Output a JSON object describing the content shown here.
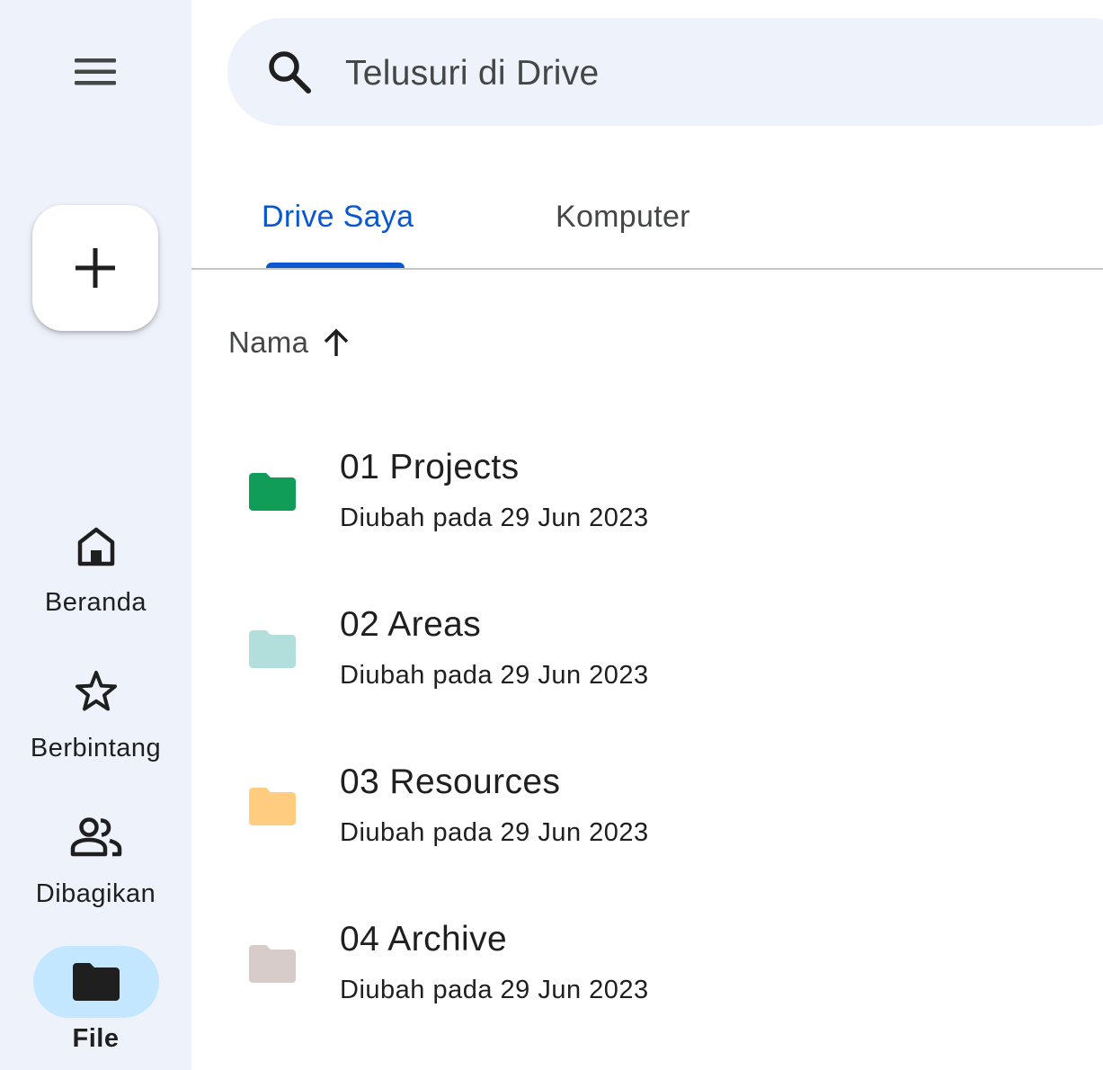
{
  "rail": {
    "menu_icon": "hamburger-menu-icon",
    "new_button_icon": "plus-icon",
    "nav": [
      {
        "label": "Beranda",
        "icon": "home-icon"
      },
      {
        "label": "Berbintang",
        "icon": "star-icon"
      },
      {
        "label": "Dibagikan",
        "icon": "people-icon"
      },
      {
        "label": "File",
        "icon": "folder-icon",
        "active": true
      }
    ],
    "active_pill_color": "#c2e7ff",
    "background": "#eef2fa"
  },
  "search": {
    "placeholder": "Telusuri di Drive",
    "icon": "search-icon"
  },
  "tabs": [
    {
      "label": "Drive Saya",
      "active": true
    },
    {
      "label": "Komputer",
      "active": false
    }
  ],
  "accent_color": "#0b57d0",
  "sort": {
    "label": "Nama",
    "direction_icon": "arrow-up-icon"
  },
  "files": [
    {
      "name": "01 Projects",
      "subtitle": "Diubah pada 29 Jun 2023",
      "folder_color": "#0f9d58"
    },
    {
      "name": "02 Areas",
      "subtitle": "Diubah pada 29 Jun 2023",
      "folder_color": "#b2dfdb"
    },
    {
      "name": "03 Resources",
      "subtitle": "Diubah pada 29 Jun 2023",
      "folder_color": "#ffcc80"
    },
    {
      "name": "04 Archive",
      "subtitle": "Diubah pada 29 Jun 2023",
      "folder_color": "#d7ccc8"
    }
  ]
}
